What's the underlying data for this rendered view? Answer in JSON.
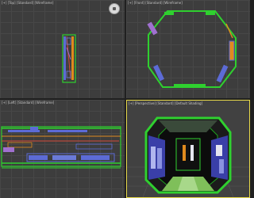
{
  "viewports": {
    "top": {
      "label": "[+] [Top] [Standard] [Wireframe]"
    },
    "front": {
      "label": "[+] [Front] [Standard] [Wireframe]"
    },
    "left": {
      "label": "[+] [Left] [Standard] [Wireframe]"
    },
    "perspective": {
      "label": "[+] [Perspective] [Standard] [Default Shading]"
    }
  },
  "colors": {
    "viewport_bg": "#3d3d3d",
    "grid": "#474747",
    "active_border": "#e7d94a",
    "wire_green": "#2fd02f",
    "wire_blue": "#5c6bd6",
    "wire_orange": "#e08a1e",
    "wire_purple": "#a070d0"
  },
  "icons": {
    "view_cube": "navigation-wheel-icon"
  }
}
